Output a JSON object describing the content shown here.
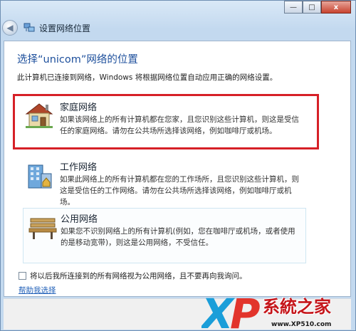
{
  "window": {
    "title": "设置网络位置",
    "minimize_icon": "minimize-icon",
    "maximize_icon": "maximize-icon",
    "close_label": "x"
  },
  "page": {
    "heading": "选择“unicom”网络的位置",
    "description": "此计算机已连接到网络，Windows 将根据网络位置自动应用正确的网络设置。"
  },
  "options": [
    {
      "id": "home",
      "title": "家庭网络",
      "description": "如果该网络上的所有计算机都在您家，且您识别这些计算机，则这是受信任的家庭网络。请勿在公共场所选择该网络，例如咖啡厅或机场。",
      "icon": "house-icon",
      "highlighted": true,
      "highlight_color": "#d62027"
    },
    {
      "id": "work",
      "title": "工作网络",
      "description": "如果此网络上的所有计算机都在您的工作场所，且您识别这些计算机，则这是受信任的工作网络。请勿在公共场所选择该网络，例如咖啡厅或机场。",
      "icon": "office-building-icon",
      "highlighted": false
    },
    {
      "id": "public",
      "title": "公用网络",
      "description": "如果您不识别网络上的所有计算机(例如，您在咖啡厅或机场，或者使用的是移动宽带)，则这是公用网络，不受信任。",
      "icon": "park-bench-icon",
      "highlighted": false
    }
  ],
  "checkbox": {
    "label": "将以后我所连接到的所有网络视为公用网络，且不要再向我询问。",
    "checked": false
  },
  "help_link": "帮助我选择",
  "watermark": {
    "logo_text": "XP",
    "site_name": "系統之家",
    "url": "www.XP510.com"
  },
  "colors": {
    "heading": "#1d4f9c",
    "link": "#1f5fb8",
    "highlight": "#d62027"
  }
}
